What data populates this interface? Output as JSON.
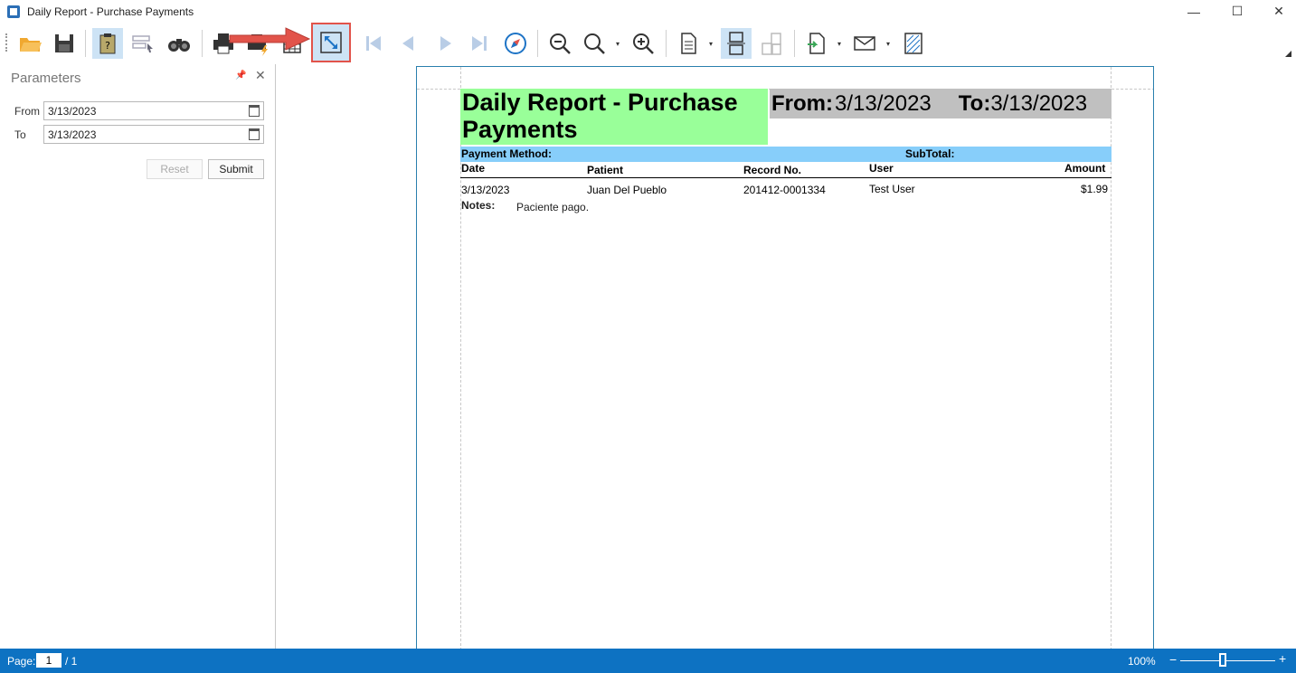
{
  "window": {
    "title": "Daily Report - Purchase Payments",
    "minimize": "—",
    "maximize": "☐",
    "close": "✕"
  },
  "toolbar": {
    "icons": [
      "open-folder-icon",
      "save-icon",
      "parameters-icon",
      "editable-fields-icon",
      "search-icon",
      "print-icon",
      "quick-print-icon",
      "page-setup-icon",
      "fit-page-icon",
      "first-page-icon",
      "previous-page-icon",
      "next-page-icon",
      "last-page-icon",
      "navigation-compass-icon",
      "zoom-out-icon",
      "zoom-icon",
      "zoom-in-icon",
      "single-page-icon",
      "multiple-pages-icon",
      "page-layout-icon",
      "export-icon",
      "email-icon",
      "watermark-icon"
    ],
    "dropdown": "▾",
    "annotation_color": "#e2534a"
  },
  "parameters": {
    "title": "Parameters",
    "pin": "📌",
    "close": "✕",
    "from_label": "From",
    "from_value": "3/13/2023",
    "to_label": "To",
    "to_value": "3/13/2023",
    "reset_label": "Reset",
    "submit_label": "Submit"
  },
  "report": {
    "title": "Daily Report - Purchase Payments",
    "from_label": "From:",
    "from_value": "3/13/2023",
    "to_label": "To:",
    "to_value": "3/13/2023",
    "payment_method_label": "Payment Method:",
    "subtotal_label": "SubTotal:",
    "columns": {
      "date": "Date",
      "patient": "Patient",
      "record_no": "Record No.",
      "user": "User",
      "amount": "Amount"
    },
    "rows": [
      {
        "date": "3/13/2023",
        "patient": "Juan Del Pueblo",
        "record_no": "201412-0001334",
        "user": "Test User",
        "amount": "$1.99",
        "notes_label": "Notes:",
        "notes": "Paciente pago."
      }
    ]
  },
  "status": {
    "page_label": "Page:",
    "current_page": "1",
    "page_of": "/ 1",
    "zoom": "100%",
    "zoom_fraction": 0.45,
    "zoom_minus": "−",
    "zoom_plus": "+"
  },
  "colors": {
    "title_bg": "#99ff99",
    "dates_bg": "#c0c0c0",
    "payment_bar_bg": "#87cefa",
    "status_bar": "#0d72c2"
  }
}
